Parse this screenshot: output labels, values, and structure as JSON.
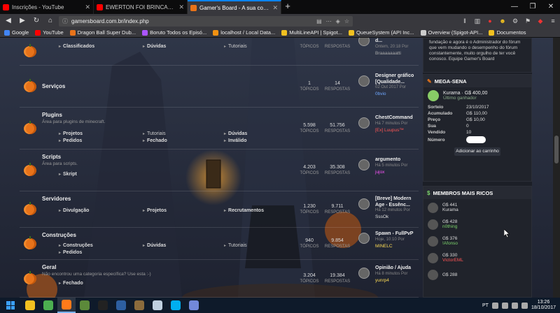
{
  "tabs": [
    {
      "title": "Inscrições - YouTube",
      "color": "#ff0000",
      "active": false
    },
    {
      "title": "EWERTON FOI BRINCAR NO",
      "color": "#ff0000",
      "active": false
    },
    {
      "title": "Gamer's Board - A sua comunid",
      "color": "#e8731a",
      "active": true
    }
  ],
  "nav": {
    "url": "gamersboard.com.br/index.php",
    "badges": {
      "notif1": "4",
      "notif2": "2"
    }
  },
  "bookmarks": [
    {
      "label": "Google",
      "color": "#4285f4"
    },
    {
      "label": "YouTube",
      "color": "#ff0000"
    },
    {
      "label": "Dragon Ball Super Dub...",
      "color": "#e8731a"
    },
    {
      "label": "Boruto Todos os Episó...",
      "color": "#aa55ff"
    },
    {
      "label": "localhost / Local Data...",
      "color": "#f29111"
    },
    {
      "label": "MultiLineAPI | Spigot...",
      "color": "#f0c020"
    },
    {
      "label": "QueueSystem (API Inc...",
      "color": "#f0c020"
    },
    {
      "label": "Overview (Spigot-API...",
      "color": "#cccccc"
    },
    {
      "label": "Documentos",
      "color": "#f0c020"
    }
  ],
  "forum_rows": [
    {
      "name": "",
      "desc": "",
      "subs": [
        {
          "label": "Classificados"
        },
        {
          "label": "Dúvidas"
        },
        {
          "label": "Tutoriais"
        }
      ],
      "topics": "",
      "posts": "",
      "topics_label": "TÓPICOS",
      "posts_label": "RESPOSTAS",
      "last": {
        "title": "d...",
        "time": "Ontem, 20:18 Por",
        "user": "Braaaaaaatti",
        "user_color": "#aaaaaa"
      }
    },
    {
      "name": "Serviços",
      "desc": "",
      "subs": [],
      "topics": "1",
      "posts": "14",
      "topics_label": "TÓPICOS",
      "posts_label": "RESPOSTAS",
      "last": {
        "title": "Designer gráfico [Qualidade...",
        "time": "02 Out 2017 Por",
        "user": "0bvio",
        "user_color": "#6fa8ff"
      }
    },
    {
      "name": "Plugins",
      "desc": "Área para plugins de minecraft.",
      "subs": [
        {
          "label": "Projetos"
        },
        {
          "label": "Tutoriais"
        },
        {
          "label": "Dúvidas"
        },
        {
          "label": "Pedidos"
        },
        {
          "label": "Fechado"
        },
        {
          "label": "Inválido"
        }
      ],
      "topics": "5.598",
      "posts": "51.756",
      "topics_label": "TÓPICOS",
      "posts_label": "RESPOSTAS",
      "last": {
        "title": "ChestCommand",
        "time": "Há 7 minutos Por",
        "user": "[Ex] Luupus™",
        "user_color": "#ff5555"
      }
    },
    {
      "name": "Scripts",
      "desc": "Área para scripts.",
      "subs": [
        {
          "label": "Skript"
        }
      ],
      "topics": "4.203",
      "posts": "35.308",
      "topics_label": "TÓPICOS",
      "posts_label": "RESPOSTAS",
      "last": {
        "title": "argumento",
        "time": "Há 5 minutos Por",
        "user": "jujox",
        "user_color": "#ff55ff"
      }
    },
    {
      "name": "Servidores",
      "desc": "",
      "subs": [
        {
          "label": "Divulgação"
        },
        {
          "label": "Projetos"
        },
        {
          "label": "Recrutamentos"
        }
      ],
      "topics": "1.230",
      "posts": "9.711",
      "topics_label": "TÓPICOS",
      "posts_label": "RESPOSTAS",
      "last": {
        "title": "[Breve] Modern Age - Essênc...",
        "time": "Há 12 minutos Por",
        "user": "SssOk",
        "user_color": "#dddddd"
      }
    },
    {
      "name": "Construções",
      "desc": "",
      "subs": [
        {
          "label": "Construções"
        },
        {
          "label": "Dúvidas"
        },
        {
          "label": "Tutoriais"
        },
        {
          "label": "Pedidos"
        }
      ],
      "topics": "940",
      "posts": "9.854",
      "topics_label": "TÓPICOS",
      "posts_label": "RESPOSTAS",
      "last": {
        "title": "Spawn - FullPvP",
        "time": "Hoje, 10:10 Por",
        "user": "MINELC",
        "user_color": "#ffdd55"
      }
    },
    {
      "name": "Geral",
      "desc": "Não encontrou uma categoria específica? Use esta :-)",
      "subs": [
        {
          "label": "Fechado"
        }
      ],
      "topics": "3.204",
      "posts": "19.384",
      "topics_label": "TÓPICOS",
      "posts_label": "RESPOSTAS",
      "last": {
        "title": "Opinião / Ajuda",
        "time": "Há 8 minutos Por",
        "user": "yunrp4",
        "user_color": "#ffdd55"
      }
    }
  ],
  "sidebar": {
    "info_text": "fundação e agora é o Administrador do fórum que vem mudando o desempenho do fórum constantemente, muito orgulho de ter você conosco. Equipe Gamer's Board",
    "mega": {
      "title": "MEGA-SENA",
      "winner_name": "Kurama · G$ 400,00",
      "winner_sub": "Último ganhador",
      "rows": [
        {
          "k": "Sorteio",
          "v": "23/10/2017"
        },
        {
          "k": "Acumulado",
          "v": "G$ 110,00"
        },
        {
          "k": "Preço",
          "v": "G$ 10,00"
        },
        {
          "k": "Sua",
          "v": "0"
        },
        {
          "k": "Vendido",
          "v": "10"
        },
        {
          "k": "Número",
          "v": ""
        }
      ],
      "button": "Adicionar ao carrinho"
    },
    "rich": {
      "title": "MEMBROS MAIS RICOS",
      "members": [
        {
          "value": "G$ 441",
          "name": "Kurama",
          "color": "#dddddd"
        },
        {
          "value": "G$ 428",
          "name": "n0thing",
          "color": "#7cd36b"
        },
        {
          "value": "G$ 376",
          "name": "!Afonso",
          "color": "#7cd36b"
        },
        {
          "value": "G$ 330",
          "name": "VictorEML",
          "color": "#ff5555"
        },
        {
          "value": "G$ 288",
          "name": "",
          "color": "#dddddd"
        }
      ]
    }
  },
  "taskbar": {
    "lang": "PT",
    "time": "13:26",
    "date": "18/10/2017",
    "apps": [
      {
        "name": "file-explorer",
        "color": "#f0c020"
      },
      {
        "name": "chrome",
        "color": "#4caf50"
      },
      {
        "name": "firefox",
        "color": "#ff7a1a"
      },
      {
        "name": "minecraft",
        "color": "#5c8a3a"
      },
      {
        "name": "app-dark",
        "color": "#222222"
      },
      {
        "name": "code-editor",
        "color": "#2d5fa0"
      },
      {
        "name": "game",
        "color": "#8a6b3c"
      },
      {
        "name": "paint",
        "color": "#c0d0e0"
      },
      {
        "name": "skype",
        "color": "#00aff0"
      },
      {
        "name": "discord",
        "color": "#7289da"
      }
    ]
  }
}
